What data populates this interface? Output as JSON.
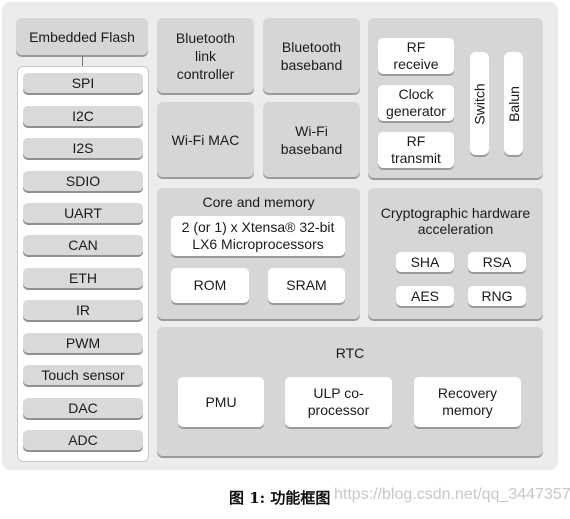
{
  "caption": "图 1: 功能框图",
  "watermark": "https://blog.csdn.net/qq_34473570",
  "embedded_flash": "Embedded Flash",
  "interfaces": [
    "SPI",
    "I2C",
    "I2S",
    "SDIO",
    "UART",
    "CAN",
    "ETH",
    "IR",
    "PWM",
    "Touch sensor",
    "DAC",
    "ADC"
  ],
  "bluetooth": {
    "link_controller": "Bluetooth link controller",
    "baseband": "Bluetooth baseband"
  },
  "wifi": {
    "mac": "Wi-Fi MAC",
    "baseband": "Wi-Fi baseband"
  },
  "rf": {
    "receive": "RF receive",
    "clock": "Clock generator",
    "transmit": "RF transmit",
    "switch": "Switch",
    "balun": "Balun"
  },
  "core": {
    "title": "Core and memory",
    "cpu": "2 (or 1) x Xtensa® 32-bit LX6 Microprocessors",
    "rom": "ROM",
    "sram": "SRAM"
  },
  "crypto": {
    "title": "Cryptographic hardware acceleration",
    "items": [
      "SHA",
      "RSA",
      "AES",
      "RNG"
    ]
  },
  "rtc": {
    "title": "RTC",
    "pmu": "PMU",
    "ulp": "ULP co-processor",
    "recovery": "Recovery memory"
  }
}
